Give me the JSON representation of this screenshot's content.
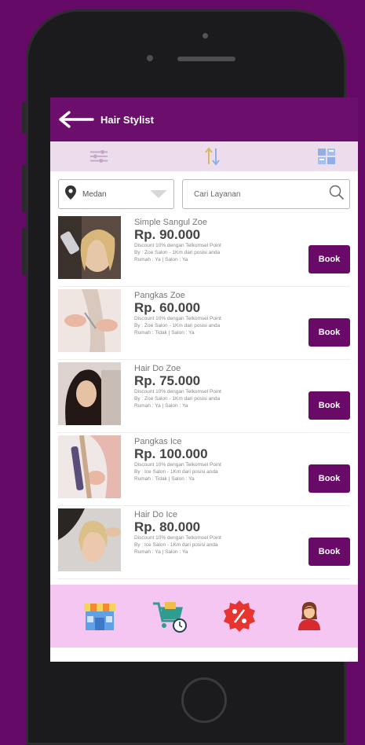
{
  "appbar": {
    "title": "Hair Stylist"
  },
  "filters": {
    "location": "Medan",
    "search_placeholder": "Cari Layanan"
  },
  "services": [
    {
      "name": "Simple Sangul Zoe",
      "price": "Rp. 90.000",
      "discount": "Discount 10% dengan Telkomsel Point",
      "by": "By : Zoe Salon - 1Km dari posisi anda",
      "rumah": "Rumah : Ya | Salon : Ya",
      "book_label": "Book"
    },
    {
      "name": "Pangkas Zoe",
      "price": "Rp. 60.000",
      "discount": "Discount 10% dengan Telkomsel Point",
      "by": "By : Zoe Salon - 1Km dari posisi anda",
      "rumah": "Rumah : Tidak | Salon : Ya",
      "book_label": "Book"
    },
    {
      "name": "Hair Do Zoe",
      "price": "Rp. 75.000",
      "discount": "Discount 10% dengan Telkomsel Point",
      "by": "By : Zoe Salon - 1Km dari posisi anda",
      "rumah": "Rumah : Ya | Salon : Ya",
      "book_label": "Book"
    },
    {
      "name": "Pangkas Ice",
      "price": "Rp. 100.000",
      "discount": "Discount 10% dengan Telkomsel Point",
      "by": "By : Ice Salon - 1Km dari posisi anda",
      "rumah": "Rumah : Tidak | Salon : Ya",
      "book_label": "Book"
    },
    {
      "name": "Hair Do Ice",
      "price": "Rp. 80.000",
      "discount": "Discount 10% dengan Telkomsel Point",
      "by": "By : Ice Salon - 1Km dari posisi anda",
      "rumah": "Rumah : Ya | Salon : Ya",
      "book_label": "Book"
    }
  ],
  "bottom_nav": {
    "icons": [
      "store-icon",
      "cart-clock-icon",
      "discount-icon",
      "profile-icon"
    ]
  },
  "colors": {
    "primary": "#6a0a68",
    "background": "#650a66",
    "toolbar": "#ecdcec",
    "bottom_nav": "#f6c6f3"
  }
}
